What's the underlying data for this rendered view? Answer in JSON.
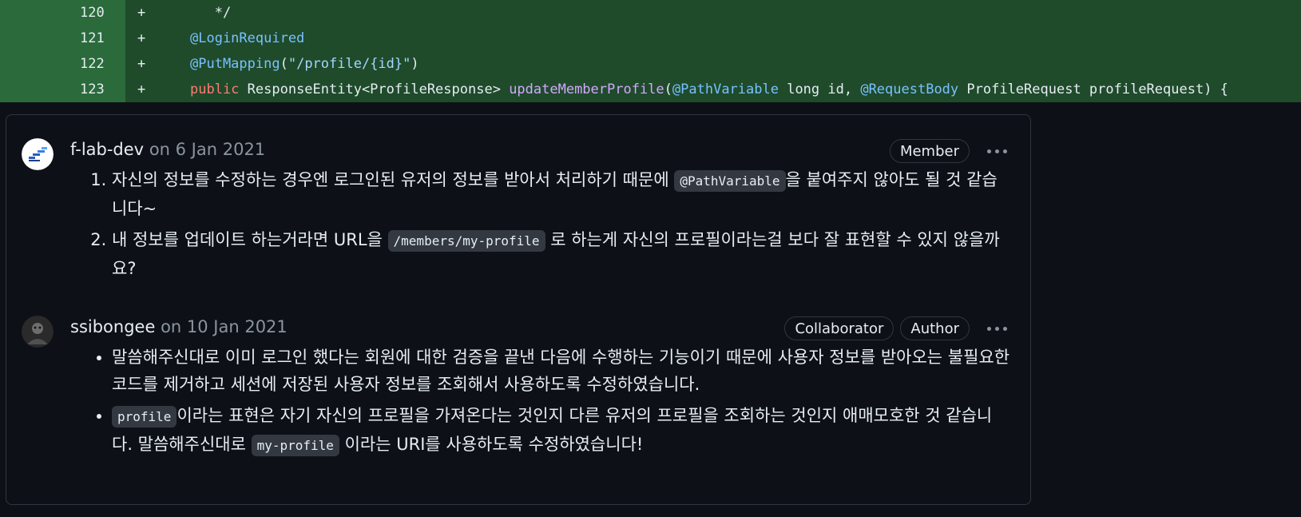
{
  "diff": {
    "lines": [
      {
        "number": "120",
        "sign": "+",
        "tokens": [
          {
            "t": "plain",
            "v": "   */"
          }
        ]
      },
      {
        "number": "121",
        "sign": "+",
        "tokens": [
          {
            "t": "anno",
            "v": "@LoginRequired"
          }
        ]
      },
      {
        "number": "122",
        "sign": "+",
        "tokens": [
          {
            "t": "anno",
            "v": "@PutMapping"
          },
          {
            "t": "plain",
            "v": "("
          },
          {
            "t": "str",
            "v": "\"/profile/{id}\""
          },
          {
            "t": "plain",
            "v": ")"
          }
        ]
      },
      {
        "number": "123",
        "sign": "+",
        "tokens": [
          {
            "t": "kw",
            "v": "public"
          },
          {
            "t": "plain",
            "v": " ResponseEntity<ProfileResponse> "
          },
          {
            "t": "fn",
            "v": "updateMemberProfile"
          },
          {
            "t": "plain",
            "v": "("
          },
          {
            "t": "anno",
            "v": "@PathVariable"
          },
          {
            "t": "plain",
            "v": " long id, "
          },
          {
            "t": "anno",
            "v": "@RequestBody"
          },
          {
            "t": "plain",
            "v": " ProfileRequest profileRequest) {"
          }
        ]
      }
    ]
  },
  "comments": [
    {
      "author": "f-lab-dev",
      "date": "on 6 Jan 2021",
      "badges": [
        "Member"
      ],
      "list_type": "ol",
      "items": [
        [
          {
            "t": "text",
            "v": "자신의 정보를 수정하는 경우엔 로그인된 유저의 정보를 받아서 처리하기 때문에 "
          },
          {
            "t": "code",
            "v": "@PathVariable"
          },
          {
            "t": "text",
            "v": "을 붙여주지 않아도 될 것 같습니다~"
          }
        ],
        [
          {
            "t": "text",
            "v": "내 정보를 업데이트 하는거라면 URL을 "
          },
          {
            "t": "code",
            "v": "/members/my-profile"
          },
          {
            "t": "text",
            "v": " 로 하는게 자신의 프로필이라는걸 보다 잘 표현할 수 있지 않을까요?"
          }
        ]
      ]
    },
    {
      "author": "ssibongee",
      "date": "on 10 Jan 2021",
      "badges": [
        "Collaborator",
        "Author"
      ],
      "list_type": "ul",
      "items": [
        [
          {
            "t": "text",
            "v": "말씀해주신대로 이미 로그인 했다는 회원에 대한 검증을 끝낸 다음에 수행하는 기능이기 때문에 사용자 정보를 받아오는 불필요한 코드를 제거하고 세션에 저장된 사용자 정보를 조회해서 사용하도록 수정하였습니다."
          }
        ],
        [
          {
            "t": "code",
            "v": "profile"
          },
          {
            "t": "text",
            "v": "이라는 표현은 자기 자신의 프로필을 가져온다는 것인지 다른 유저의 프로필을 조회하는 것인지 애매모호한 것 같습니다. 말씀해주신대로 "
          },
          {
            "t": "code",
            "v": "my-profile"
          },
          {
            "t": "text",
            "v": " 이라는 URI를 사용하도록 수정하였습니다!"
          }
        ]
      ]
    }
  ],
  "colors": {
    "diff_bg": "#1f4b2b",
    "gutter_bg": "#2b6a3b",
    "page_bg": "#0d1117",
    "annotation": "#79c0ff",
    "keyword": "#ff7b72",
    "function": "#d2a8ff"
  },
  "icons": [
    "kebab-menu-icon",
    "avatar-f-lab-dev",
    "avatar-ssibongee"
  ]
}
